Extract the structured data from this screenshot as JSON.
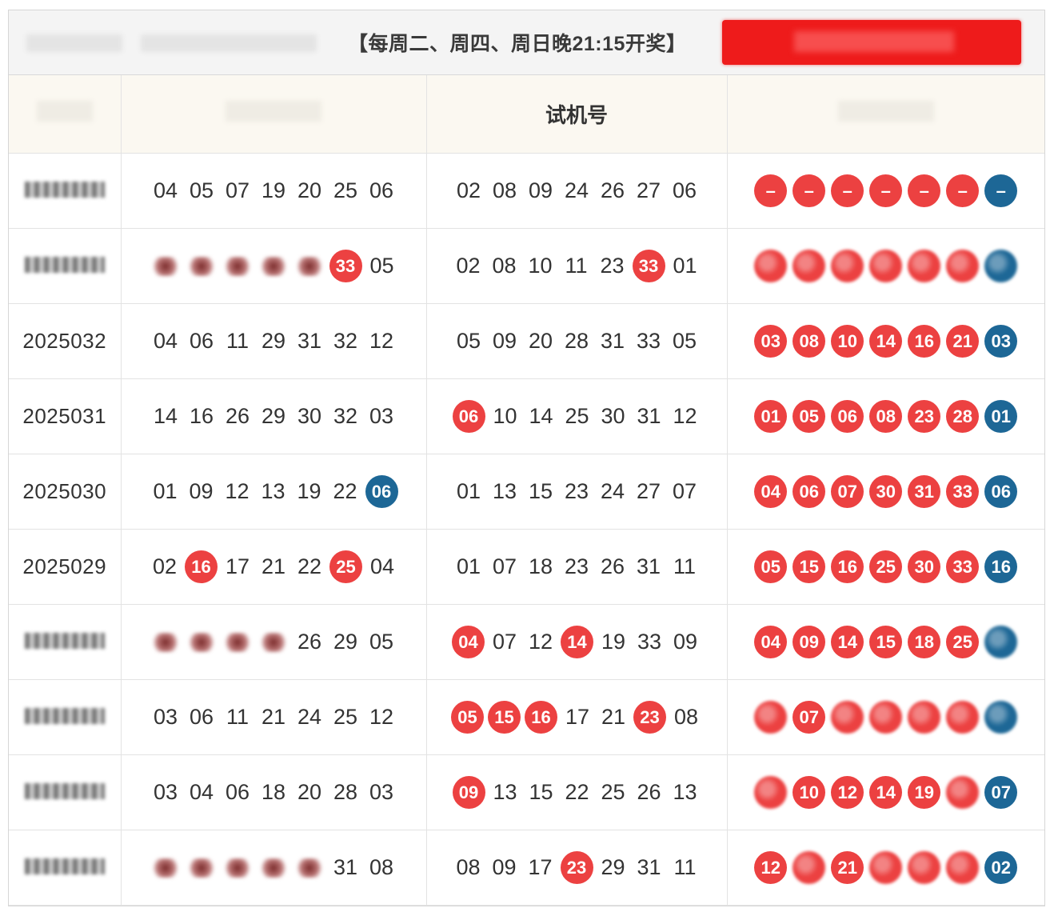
{
  "header": {
    "schedule": "【每周二、周四、周日晚21:15开奖】"
  },
  "columns": {
    "issue": "",
    "draw": "",
    "test": "试机号",
    "pick": ""
  },
  "colors": {
    "red_ball": "#ec4141",
    "blue_ball": "#1d6796",
    "button": "#ee1b1b",
    "header_bg": "#fbf8f1"
  },
  "rows": [
    {
      "issue": "",
      "issue_blurred": true,
      "draw": [
        {
          "v": "04"
        },
        {
          "v": "05"
        },
        {
          "v": "07"
        },
        {
          "v": "19"
        },
        {
          "v": "20"
        },
        {
          "v": "25"
        },
        {
          "v": "06"
        }
      ],
      "test": [
        {
          "v": "02"
        },
        {
          "v": "08"
        },
        {
          "v": "09"
        },
        {
          "v": "24"
        },
        {
          "v": "26"
        },
        {
          "v": "27"
        },
        {
          "v": "06"
        }
      ],
      "pick": [
        {
          "v": "–",
          "c": "red"
        },
        {
          "v": "–",
          "c": "red"
        },
        {
          "v": "–",
          "c": "red"
        },
        {
          "v": "–",
          "c": "red"
        },
        {
          "v": "–",
          "c": "red"
        },
        {
          "v": "–",
          "c": "red"
        },
        {
          "v": "–",
          "c": "blue"
        }
      ]
    },
    {
      "issue": "",
      "issue_blurred": true,
      "draw": [
        {
          "v": "",
          "blur": true
        },
        {
          "v": "",
          "blur": true
        },
        {
          "v": "",
          "blur": true
        },
        {
          "v": "",
          "blur": true
        },
        {
          "v": "",
          "blur": true
        },
        {
          "v": "33",
          "hit": "red"
        },
        {
          "v": "05"
        }
      ],
      "test": [
        {
          "v": "02"
        },
        {
          "v": "08"
        },
        {
          "v": "10"
        },
        {
          "v": "11"
        },
        {
          "v": "23"
        },
        {
          "v": "33",
          "hit": "red"
        },
        {
          "v": "01"
        }
      ],
      "pick": [
        {
          "v": "",
          "c": "red",
          "blur": true
        },
        {
          "v": "",
          "c": "red",
          "blur": true
        },
        {
          "v": "",
          "c": "red",
          "blur": true
        },
        {
          "v": "",
          "c": "red",
          "blur": true
        },
        {
          "v": "",
          "c": "red",
          "blur": true
        },
        {
          "v": "",
          "c": "red",
          "blur": true
        },
        {
          "v": "",
          "c": "blue",
          "blur": true
        }
      ]
    },
    {
      "issue": "2025032",
      "draw": [
        {
          "v": "04"
        },
        {
          "v": "06"
        },
        {
          "v": "11"
        },
        {
          "v": "29"
        },
        {
          "v": "31"
        },
        {
          "v": "32"
        },
        {
          "v": "12"
        }
      ],
      "test": [
        {
          "v": "05"
        },
        {
          "v": "09"
        },
        {
          "v": "20"
        },
        {
          "v": "28"
        },
        {
          "v": "31"
        },
        {
          "v": "33"
        },
        {
          "v": "05"
        }
      ],
      "pick": [
        {
          "v": "03",
          "c": "red"
        },
        {
          "v": "08",
          "c": "red"
        },
        {
          "v": "10",
          "c": "red"
        },
        {
          "v": "14",
          "c": "red"
        },
        {
          "v": "16",
          "c": "red"
        },
        {
          "v": "21",
          "c": "red"
        },
        {
          "v": "03",
          "c": "blue"
        }
      ]
    },
    {
      "issue": "2025031",
      "draw": [
        {
          "v": "14"
        },
        {
          "v": "16"
        },
        {
          "v": "26"
        },
        {
          "v": "29"
        },
        {
          "v": "30"
        },
        {
          "v": "32"
        },
        {
          "v": "03"
        }
      ],
      "test": [
        {
          "v": "06",
          "hit": "red"
        },
        {
          "v": "10"
        },
        {
          "v": "14"
        },
        {
          "v": "25"
        },
        {
          "v": "30"
        },
        {
          "v": "31"
        },
        {
          "v": "12"
        }
      ],
      "pick": [
        {
          "v": "01",
          "c": "red"
        },
        {
          "v": "05",
          "c": "red"
        },
        {
          "v": "06",
          "c": "red"
        },
        {
          "v": "08",
          "c": "red"
        },
        {
          "v": "23",
          "c": "red"
        },
        {
          "v": "28",
          "c": "red"
        },
        {
          "v": "01",
          "c": "blue"
        }
      ]
    },
    {
      "issue": "2025030",
      "draw": [
        {
          "v": "01"
        },
        {
          "v": "09"
        },
        {
          "v": "12"
        },
        {
          "v": "13"
        },
        {
          "v": "19"
        },
        {
          "v": "22"
        },
        {
          "v": "06",
          "hit": "blue"
        }
      ],
      "test": [
        {
          "v": "01"
        },
        {
          "v": "13"
        },
        {
          "v": "15"
        },
        {
          "v": "23"
        },
        {
          "v": "24"
        },
        {
          "v": "27"
        },
        {
          "v": "07"
        }
      ],
      "pick": [
        {
          "v": "04",
          "c": "red"
        },
        {
          "v": "06",
          "c": "red"
        },
        {
          "v": "07",
          "c": "red"
        },
        {
          "v": "30",
          "c": "red"
        },
        {
          "v": "31",
          "c": "red"
        },
        {
          "v": "33",
          "c": "red"
        },
        {
          "v": "06",
          "c": "blue"
        }
      ]
    },
    {
      "issue": "2025029",
      "draw": [
        {
          "v": "02"
        },
        {
          "v": "16",
          "hit": "red"
        },
        {
          "v": "17"
        },
        {
          "v": "21"
        },
        {
          "v": "22"
        },
        {
          "v": "25",
          "hit": "red"
        },
        {
          "v": "04"
        }
      ],
      "test": [
        {
          "v": "01"
        },
        {
          "v": "07"
        },
        {
          "v": "18"
        },
        {
          "v": "23"
        },
        {
          "v": "26"
        },
        {
          "v": "31"
        },
        {
          "v": "11"
        }
      ],
      "pick": [
        {
          "v": "05",
          "c": "red"
        },
        {
          "v": "15",
          "c": "red"
        },
        {
          "v": "16",
          "c": "red"
        },
        {
          "v": "25",
          "c": "red"
        },
        {
          "v": "30",
          "c": "red"
        },
        {
          "v": "33",
          "c": "red"
        },
        {
          "v": "16",
          "c": "blue"
        }
      ]
    },
    {
      "issue": "",
      "issue_blurred": true,
      "draw": [
        {
          "v": "",
          "blur": true
        },
        {
          "v": "",
          "blur": true
        },
        {
          "v": "",
          "blur": true
        },
        {
          "v": "",
          "blur": true
        },
        {
          "v": "26"
        },
        {
          "v": "29"
        },
        {
          "v": "05"
        }
      ],
      "test": [
        {
          "v": "04",
          "hit": "red"
        },
        {
          "v": "07"
        },
        {
          "v": "12"
        },
        {
          "v": "14",
          "hit": "red"
        },
        {
          "v": "19"
        },
        {
          "v": "33"
        },
        {
          "v": "09"
        }
      ],
      "pick": [
        {
          "v": "04",
          "c": "red"
        },
        {
          "v": "09",
          "c": "red"
        },
        {
          "v": "14",
          "c": "red"
        },
        {
          "v": "15",
          "c": "red"
        },
        {
          "v": "18",
          "c": "red"
        },
        {
          "v": "25",
          "c": "red"
        },
        {
          "v": "",
          "c": "blue",
          "blur": true
        }
      ]
    },
    {
      "issue": "",
      "issue_blurred": true,
      "draw": [
        {
          "v": "03"
        },
        {
          "v": "06"
        },
        {
          "v": "11"
        },
        {
          "v": "21"
        },
        {
          "v": "24"
        },
        {
          "v": "25"
        },
        {
          "v": "12"
        }
      ],
      "test": [
        {
          "v": "05",
          "hit": "red"
        },
        {
          "v": "15",
          "hit": "red"
        },
        {
          "v": "16",
          "hit": "red"
        },
        {
          "v": "17"
        },
        {
          "v": "21"
        },
        {
          "v": "23",
          "hit": "red"
        },
        {
          "v": "08"
        }
      ],
      "pick": [
        {
          "v": "",
          "c": "red",
          "blur": true
        },
        {
          "v": "07",
          "c": "red"
        },
        {
          "v": "",
          "c": "red",
          "blur": true
        },
        {
          "v": "",
          "c": "red",
          "blur": true
        },
        {
          "v": "",
          "c": "red",
          "blur": true
        },
        {
          "v": "",
          "c": "red",
          "blur": true
        },
        {
          "v": "",
          "c": "blue",
          "blur": true
        }
      ]
    },
    {
      "issue": "",
      "issue_blurred": true,
      "draw": [
        {
          "v": "03"
        },
        {
          "v": "04"
        },
        {
          "v": "06"
        },
        {
          "v": "18"
        },
        {
          "v": "20"
        },
        {
          "v": "28"
        },
        {
          "v": "03"
        }
      ],
      "test": [
        {
          "v": "09",
          "hit": "red"
        },
        {
          "v": "13"
        },
        {
          "v": "15"
        },
        {
          "v": "22"
        },
        {
          "v": "25"
        },
        {
          "v": "26"
        },
        {
          "v": "13"
        }
      ],
      "pick": [
        {
          "v": "",
          "c": "red",
          "blur": true
        },
        {
          "v": "10",
          "c": "red"
        },
        {
          "v": "12",
          "c": "red"
        },
        {
          "v": "14",
          "c": "red"
        },
        {
          "v": "19",
          "c": "red"
        },
        {
          "v": "",
          "c": "red",
          "blur": true
        },
        {
          "v": "07",
          "c": "blue"
        }
      ]
    },
    {
      "issue": "",
      "issue_blurred": true,
      "draw": [
        {
          "v": "",
          "blur": true
        },
        {
          "v": "",
          "blur": true
        },
        {
          "v": "",
          "blur": true
        },
        {
          "v": "",
          "blur": true
        },
        {
          "v": "",
          "blur": true
        },
        {
          "v": "31"
        },
        {
          "v": "08"
        }
      ],
      "test": [
        {
          "v": "08"
        },
        {
          "v": "09"
        },
        {
          "v": "17"
        },
        {
          "v": "23",
          "hit": "red"
        },
        {
          "v": "29"
        },
        {
          "v": "31"
        },
        {
          "v": "11"
        }
      ],
      "pick": [
        {
          "v": "12",
          "c": "red"
        },
        {
          "v": "",
          "c": "red",
          "blur": true
        },
        {
          "v": "21",
          "c": "red"
        },
        {
          "v": "",
          "c": "red",
          "blur": true
        },
        {
          "v": "",
          "c": "red",
          "blur": true
        },
        {
          "v": "",
          "c": "red",
          "blur": true
        },
        {
          "v": "02",
          "c": "blue"
        }
      ]
    }
  ]
}
